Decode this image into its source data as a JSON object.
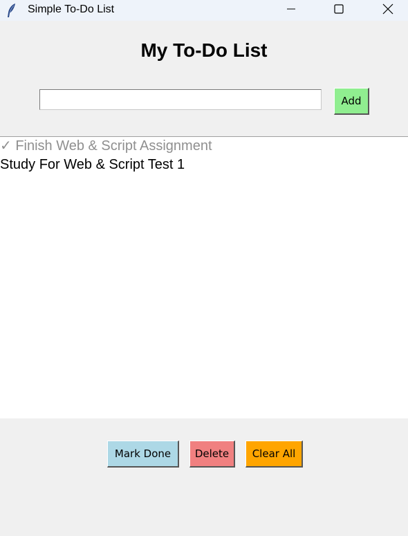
{
  "window": {
    "title": "Simple To-Do List",
    "controls": {
      "minimize_icon": "minimize-icon",
      "maximize_icon": "maximize-icon",
      "close_icon": "close-icon"
    },
    "app_icon": "feather-icon"
  },
  "header": {
    "title": "My To-Do List"
  },
  "entry": {
    "value": "",
    "placeholder": "",
    "add_label": "Add",
    "add_color": "#90ee90"
  },
  "tasks": [
    {
      "text": "✓ Finish Web & Script Assignment",
      "done": true
    },
    {
      "text": "Study For Web & Script Test 1",
      "done": false
    }
  ],
  "actions": {
    "mark_done_label": "Mark Done",
    "mark_done_color": "#add8e6",
    "delete_label": "Delete",
    "delete_color": "#f08080",
    "clear_all_label": "Clear All",
    "clear_all_color": "#ffa500"
  },
  "colors": {
    "done_text": "#8f8f8f",
    "pending_text": "#000000",
    "background": "#f0f0f0",
    "titlebar": "#eef3fa"
  }
}
